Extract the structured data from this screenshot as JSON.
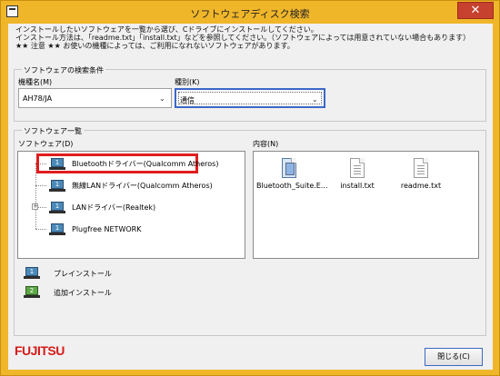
{
  "window": {
    "title": "ソフトウェアディスク検索",
    "close_glyph": "✕"
  },
  "intro": {
    "line1": "インストールしたいソフトウェアを一覧から選び、Cドライブにインストールしてください。",
    "line2": "インストール方法は、「readme.txt」「install.txt」などを参照してください。（ソフトウェアによっては用意されていない場合もあります）",
    "line3": "★★ 注意 ★★ お使いの機種によっては、ご利用になれないソフトウェアがあります。"
  },
  "search": {
    "group_label": "ソフトウェアの検索条件",
    "model_label": "機種名(M)",
    "model_value": "AH78/JA",
    "type_label": "種別(K)",
    "type_value": "通信"
  },
  "software_list": {
    "group_label": "ソフトウェア一覧",
    "software_label": "ソフトウェア(D)",
    "items": [
      {
        "name": "Bluetoothドライバー(Qualcomm Atheros)",
        "install_type": "1"
      },
      {
        "name": "無線LANドライバー(Qualcomm Atheros)",
        "install_type": "1"
      },
      {
        "name": "LANドライバー(Realtek)",
        "install_type": "1"
      },
      {
        "name": "Plugfree NETWORK",
        "install_type": "1"
      }
    ],
    "content_label": "内容(N)",
    "files": [
      "Bluetooth_Suite.E...",
      "install.txt",
      "readme.txt"
    ]
  },
  "legend": {
    "preinstall_label": "プレインストール",
    "preinstall_icon_text": "1",
    "add_install_label": "追加インストール",
    "add_install_icon_text": "2"
  },
  "footer": {
    "brand": "FUJITSU",
    "close_button": "閉じる(C)"
  },
  "colors": {
    "titlebar": "#f0b62a",
    "close": "#c7412f",
    "highlight": "#e01d1d",
    "brand": "#d51b1b"
  },
  "icons": {
    "app": "app-window-icon",
    "close": "close-icon",
    "dropdown": "chevron-down-icon",
    "computer": "computer-icon",
    "file": "file-icon",
    "exe": "executable-icon"
  }
}
